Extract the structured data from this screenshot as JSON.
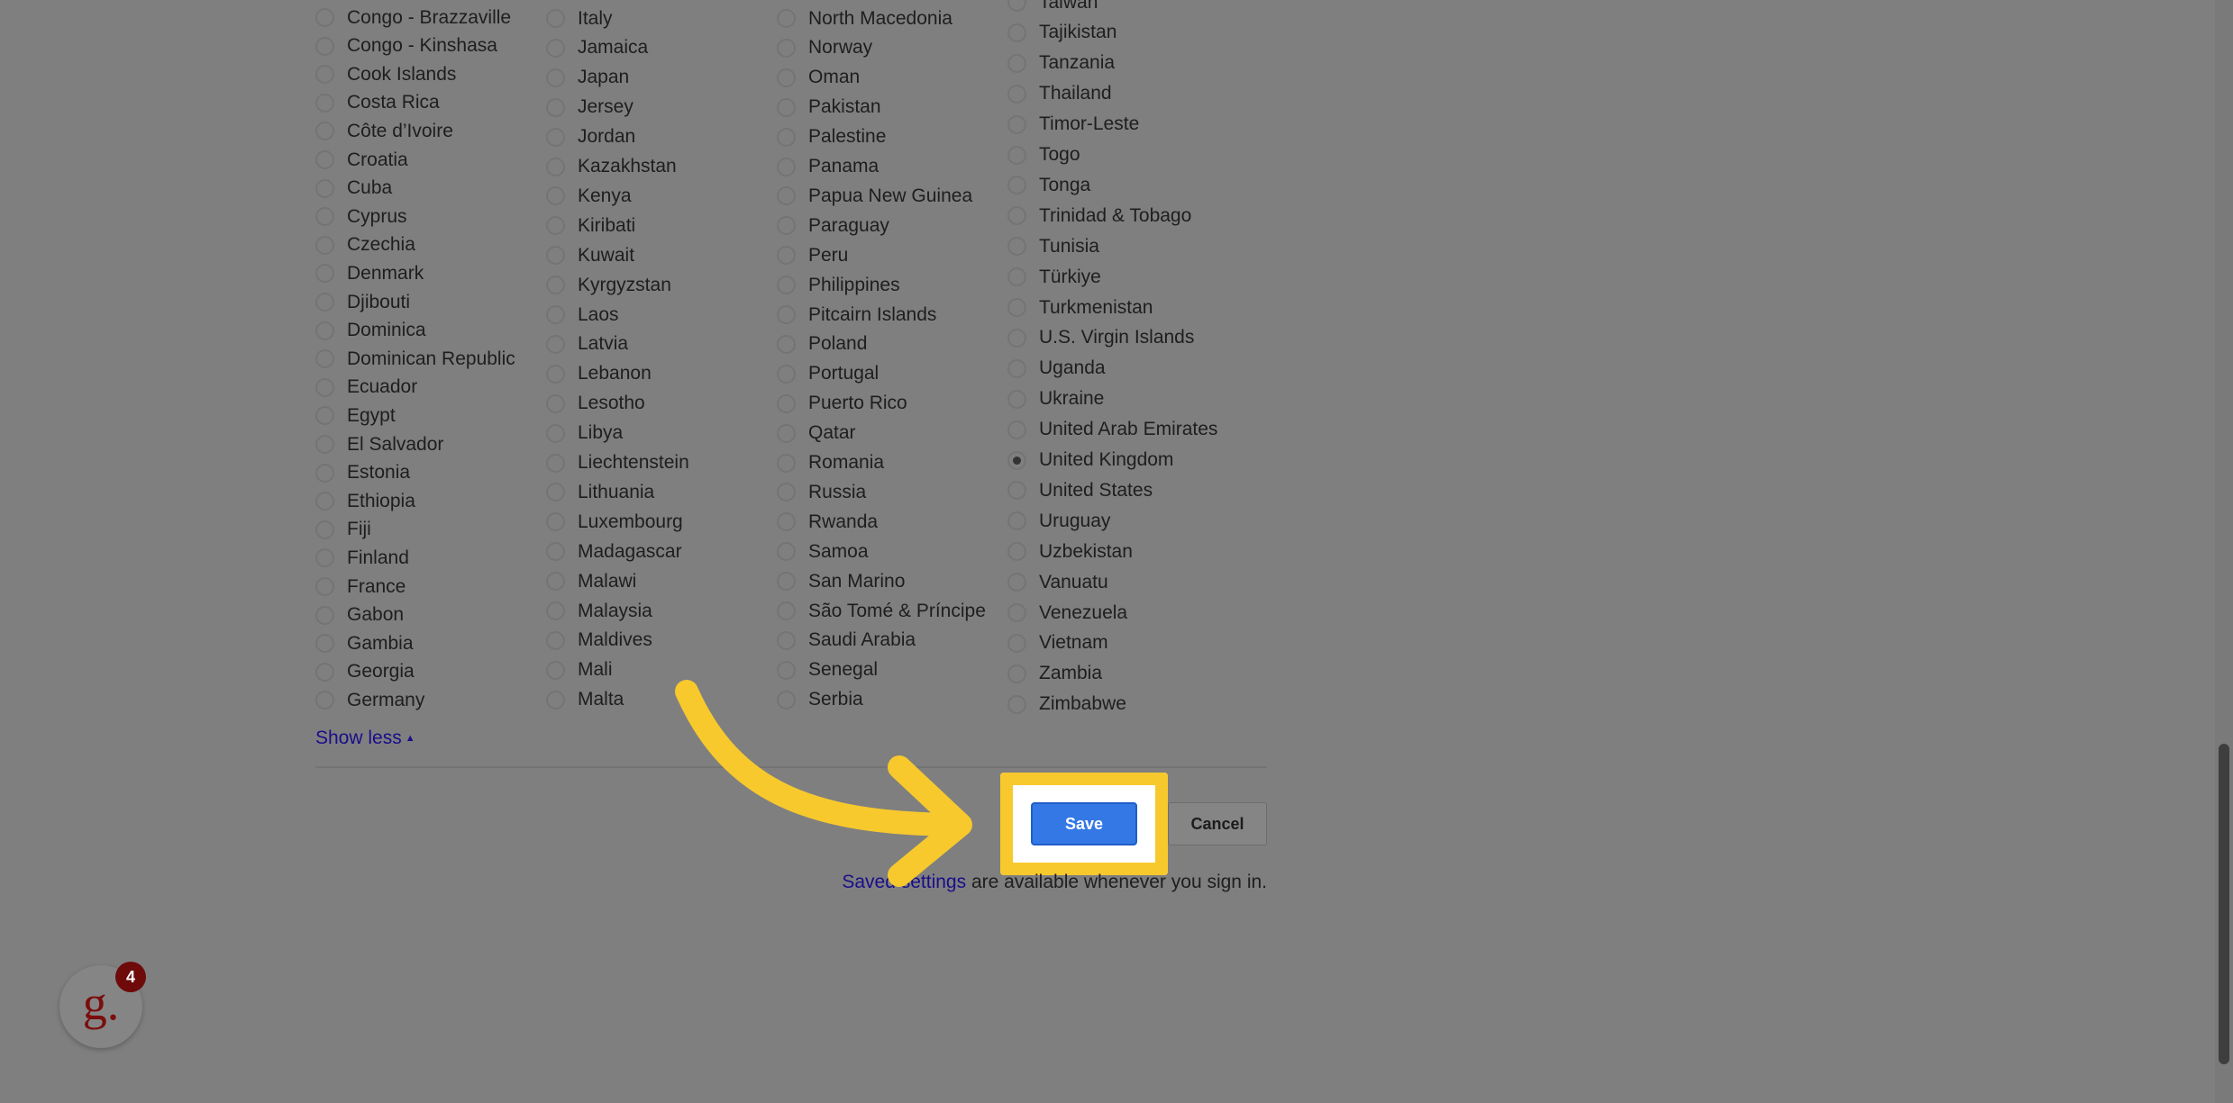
{
  "countries": {
    "col1": [
      "Congo - Brazzaville",
      "Congo - Kinshasa",
      "Cook Islands",
      "Costa Rica",
      "Côte d’Ivoire",
      "Croatia",
      "Cuba",
      "Cyprus",
      "Czechia",
      "Denmark",
      "Djibouti",
      "Dominica",
      "Dominican Republic",
      "Ecuador",
      "Egypt",
      "El Salvador",
      "Estonia",
      "Ethiopia",
      "Fiji",
      "Finland",
      "France",
      "Gabon",
      "Gambia",
      "Georgia",
      "Germany"
    ],
    "col2": [
      "Italy",
      "Jamaica",
      "Japan",
      "Jersey",
      "Jordan",
      "Kazakhstan",
      "Kenya",
      "Kiribati",
      "Kuwait",
      "Kyrgyzstan",
      "Laos",
      "Latvia",
      "Lebanon",
      "Lesotho",
      "Libya",
      "Liechtenstein",
      "Lithuania",
      "Luxembourg",
      "Madagascar",
      "Malawi",
      "Malaysia",
      "Maldives",
      "Mali",
      "Malta"
    ],
    "col3": [
      "North Macedonia",
      "Norway",
      "Oman",
      "Pakistan",
      "Palestine",
      "Panama",
      "Papua New Guinea",
      "Paraguay",
      "Peru",
      "Philippines",
      "Pitcairn Islands",
      "Poland",
      "Portugal",
      "Puerto Rico",
      "Qatar",
      "Romania",
      "Russia",
      "Rwanda",
      "Samoa",
      "San Marino",
      "São Tomé & Príncipe",
      "Saudi Arabia",
      "Senegal",
      "Serbia"
    ],
    "col4": [
      "Taiwan",
      "Tajikistan",
      "Tanzania",
      "Thailand",
      "Timor-Leste",
      "Togo",
      "Tonga",
      "Trinidad & Tobago",
      "Tunisia",
      "Türkiye",
      "Turkmenistan",
      "U.S. Virgin Islands",
      "Uganda",
      "Ukraine",
      "United Arab Emirates",
      "United Kingdom",
      "United States",
      "Uruguay",
      "Uzbekistan",
      "Vanuatu",
      "Venezuela",
      "Vietnam",
      "Zambia",
      "Zimbabwe"
    ]
  },
  "selected_country": "United Kingdom",
  "show_less_label": "Show less",
  "save_label": "Save",
  "cancel_label": "Cancel",
  "saved_note": {
    "link": "Saved settings",
    "rest": " are available whenever you sign in."
  },
  "grammarly_badge": "4",
  "grammarly_letter": "g.",
  "colors": {
    "highlight": "#f7c92d",
    "save_button": "#3478e6",
    "link": "#1a0d8b"
  }
}
